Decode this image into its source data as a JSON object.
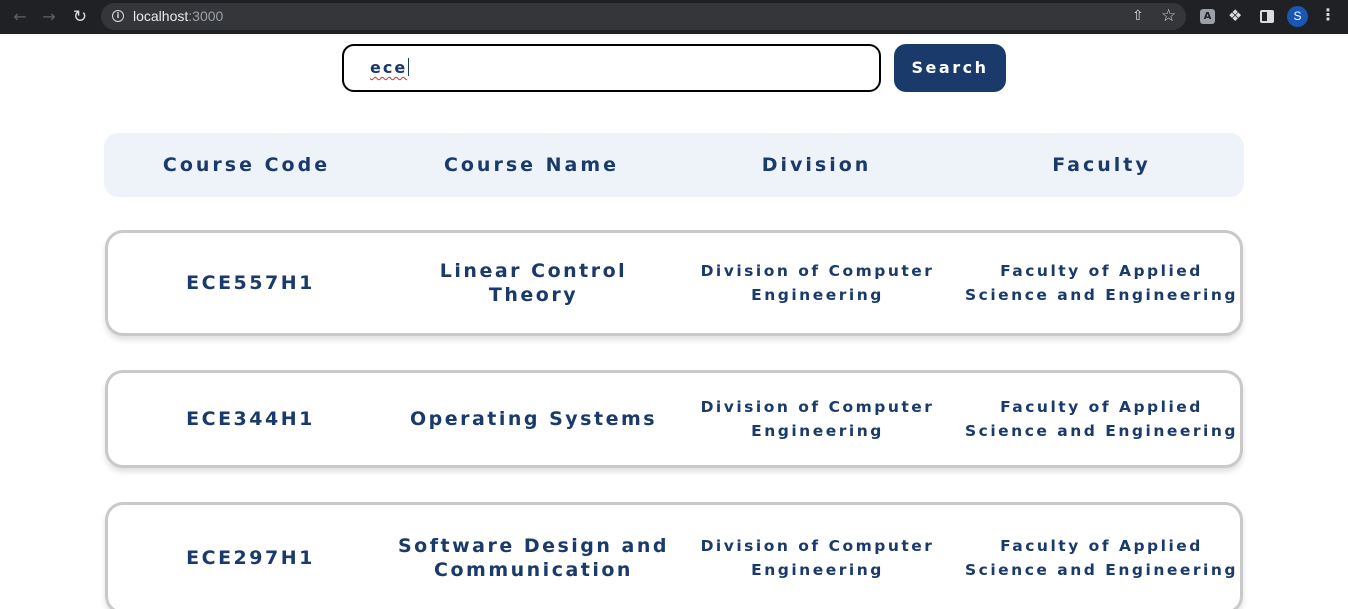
{
  "browser": {
    "url_host": "localhost",
    "url_port": ":3000",
    "profile_initial": "S",
    "extension_label": "A",
    "icons": [
      "back-icon",
      "forward-icon",
      "reload-icon",
      "info-icon",
      "share-icon",
      "star-icon",
      "extension-icon",
      "puzzle-icon",
      "side-panel-icon",
      "menu-icon"
    ]
  },
  "search": {
    "value": "ece",
    "button_label": "Search"
  },
  "table": {
    "headers": [
      "Course Code",
      "Course Name",
      "Division",
      "Faculty"
    ],
    "rows": [
      {
        "code": "ECE557H1",
        "name": "Linear Control Theory",
        "division": "Division of Computer Engineering",
        "faculty": "Faculty of Applied Science and Engineering"
      },
      {
        "code": "ECE344H1",
        "name": "Operating Systems",
        "division": "Division of Computer Engineering",
        "faculty": "Faculty of Applied Science and Engineering"
      },
      {
        "code": "ECE297H1",
        "name": "Software Design and Communication",
        "division": "Division of Computer Engineering",
        "faculty": "Faculty of Applied Science and Engineering"
      }
    ]
  },
  "colors": {
    "primary": "#1a3a6b",
    "header_bg": "#eef3fa",
    "card_border": "#c9c9c9",
    "chrome_bg": "#202124"
  }
}
